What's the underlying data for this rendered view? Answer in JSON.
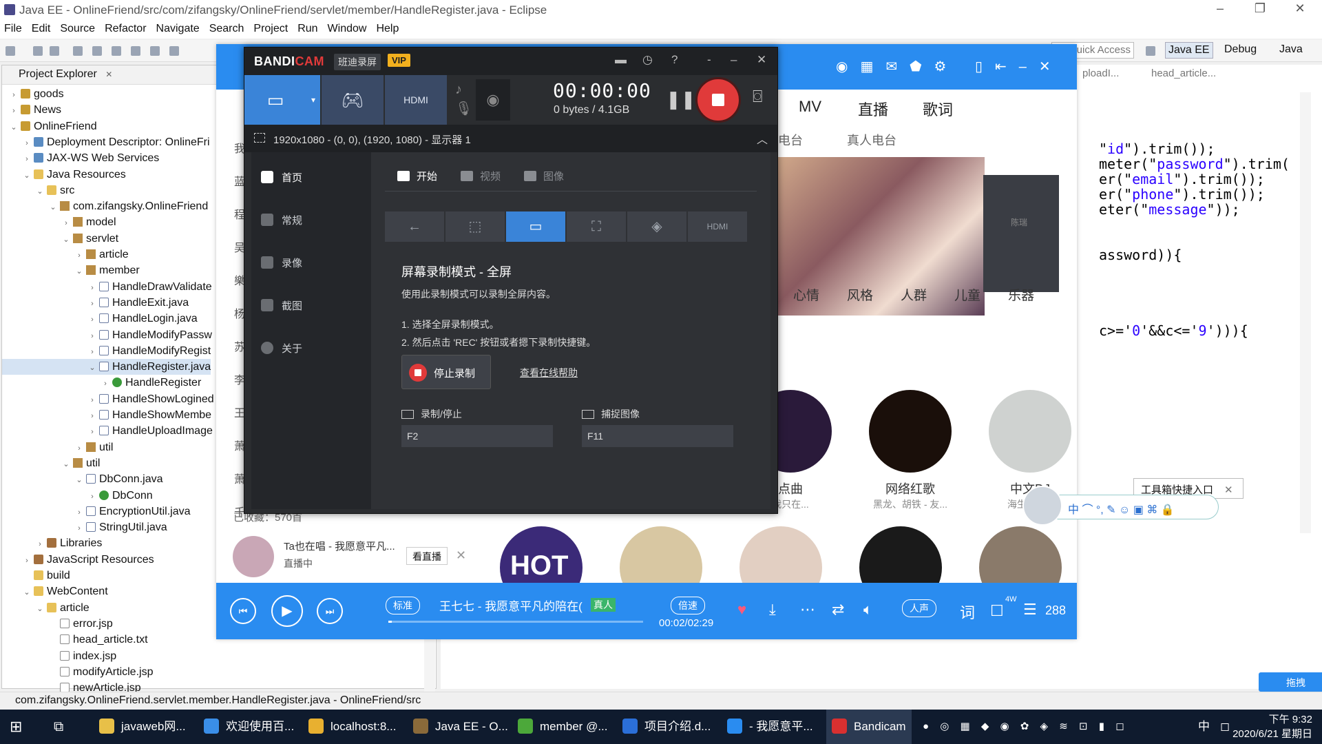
{
  "eclipse": {
    "title": "Java EE - OnlineFriend/src/com/zifangsky/OnlineFriend/servlet/member/HandleRegister.java - Eclipse",
    "menu": [
      "File",
      "Edit",
      "Source",
      "Refactor",
      "Navigate",
      "Search",
      "Project",
      "Run",
      "Window",
      "Help"
    ],
    "quick_access": "Quick Access",
    "perspectives": [
      "Java EE",
      "Debug",
      "Java"
    ],
    "explorer_title": "Project Explorer",
    "explorer_close": "✕",
    "tree": [
      {
        "label": "goods",
        "depth": 0,
        "twisty": "›",
        "icon": "proj"
      },
      {
        "label": "News",
        "depth": 0,
        "twisty": "›",
        "icon": "proj"
      },
      {
        "label": "OnlineFriend",
        "depth": 0,
        "twisty": "⌄",
        "icon": "proj"
      },
      {
        "label": "Deployment Descriptor: OnlineFri",
        "depth": 1,
        "twisty": "›",
        "icon": "web"
      },
      {
        "label": "JAX-WS Web Services",
        "depth": 1,
        "twisty": "›",
        "icon": "web"
      },
      {
        "label": "Java Resources",
        "depth": 1,
        "twisty": "⌄",
        "icon": "folder"
      },
      {
        "label": "src",
        "depth": 2,
        "twisty": "⌄",
        "icon": "folder"
      },
      {
        "label": "com.zifangsky.OnlineFriend",
        "depth": 3,
        "twisty": "⌄",
        "icon": "pkg"
      },
      {
        "label": "model",
        "depth": 4,
        "twisty": "›",
        "icon": "pkg"
      },
      {
        "label": "servlet",
        "depth": 4,
        "twisty": "⌄",
        "icon": "pkg"
      },
      {
        "label": "article",
        "depth": 5,
        "twisty": "›",
        "icon": "pkg"
      },
      {
        "label": "member",
        "depth": 5,
        "twisty": "⌄",
        "icon": "pkg"
      },
      {
        "label": "HandleDrawValidate",
        "depth": 6,
        "twisty": "›",
        "icon": "java"
      },
      {
        "label": "HandleExit.java",
        "depth": 6,
        "twisty": "›",
        "icon": "java"
      },
      {
        "label": "HandleLogin.java",
        "depth": 6,
        "twisty": "›",
        "icon": "java"
      },
      {
        "label": "HandleModifyPassw",
        "depth": 6,
        "twisty": "›",
        "icon": "java"
      },
      {
        "label": "HandleModifyRegist",
        "depth": 6,
        "twisty": "›",
        "icon": "java"
      },
      {
        "label": "HandleRegister.java",
        "depth": 6,
        "twisty": "⌄",
        "icon": "java",
        "selected": true
      },
      {
        "label": "HandleRegister",
        "depth": 7,
        "twisty": "›",
        "icon": "class"
      },
      {
        "label": "HandleShowLogined",
        "depth": 6,
        "twisty": "›",
        "icon": "java"
      },
      {
        "label": "HandleShowMembe",
        "depth": 6,
        "twisty": "›",
        "icon": "java"
      },
      {
        "label": "HandleUploadImage",
        "depth": 6,
        "twisty": "›",
        "icon": "java"
      },
      {
        "label": "util",
        "depth": 5,
        "twisty": "›",
        "icon": "pkg"
      },
      {
        "label": "util",
        "depth": 4,
        "twisty": "⌄",
        "icon": "pkg"
      },
      {
        "label": "DbConn.java",
        "depth": 5,
        "twisty": "⌄",
        "icon": "java"
      },
      {
        "label": "DbConn",
        "depth": 6,
        "twisty": "›",
        "icon": "class"
      },
      {
        "label": "EncryptionUtil.java",
        "depth": 5,
        "twisty": "›",
        "icon": "java"
      },
      {
        "label": "StringUtil.java",
        "depth": 5,
        "twisty": "›",
        "icon": "java"
      },
      {
        "label": "Libraries",
        "depth": 2,
        "twisty": "›",
        "icon": "lib"
      },
      {
        "label": "JavaScript Resources",
        "depth": 1,
        "twisty": "›",
        "icon": "lib"
      },
      {
        "label": "build",
        "depth": 1,
        "twisty": "",
        "icon": "folder"
      },
      {
        "label": "WebContent",
        "depth": 1,
        "twisty": "⌄",
        "icon": "folder"
      },
      {
        "label": "article",
        "depth": 2,
        "twisty": "⌄",
        "icon": "folder"
      },
      {
        "label": "error.jsp",
        "depth": 3,
        "twisty": "",
        "icon": "file"
      },
      {
        "label": "head_article.txt",
        "depth": 3,
        "twisty": "",
        "icon": "file"
      },
      {
        "label": "index.jsp",
        "depth": 3,
        "twisty": "",
        "icon": "file"
      },
      {
        "label": "modifyArticle.jsp",
        "depth": 3,
        "twisty": "",
        "icon": "file"
      },
      {
        "label": "newArticle.jsp",
        "depth": 3,
        "twisty": "",
        "icon": "file"
      }
    ],
    "editor_tabs": [
      "ploadI...",
      "head_article..."
    ],
    "code_lines": [
      {
        "parts": [
          [
            "",
            "\""
          ],
          [
            "s",
            "id"
          ],
          [
            "",
            "\").trim());"
          ]
        ]
      },
      {
        "parts": [
          [
            "",
            "meter(\""
          ],
          [
            "s",
            "password"
          ],
          [
            "",
            "\").trim("
          ]
        ]
      },
      {
        "parts": [
          [
            "",
            "er(\""
          ],
          [
            "s",
            "email"
          ],
          [
            "",
            "\").trim());"
          ]
        ]
      },
      {
        "parts": [
          [
            "",
            "er(\""
          ],
          [
            "s",
            "phone"
          ],
          [
            "",
            "\").trim());"
          ]
        ]
      },
      {
        "parts": [
          [
            "",
            "eter(\""
          ],
          [
            "s",
            "message"
          ],
          [
            "",
            "\"));"
          ]
        ]
      },
      {
        "parts": [
          [
            "",
            "assword)){"
          ]
        ]
      },
      {
        "parts": [
          [
            "",
            "c>='"
          ],
          [
            "s",
            "0"
          ],
          [
            "",
            "'&&c<='"
          ],
          [
            "s",
            "9"
          ],
          [
            "",
            "'))){"
          ]
        ]
      }
    ],
    "status_text": "com.zifangsky.OnlineFriend.servlet.member.HandleRegister.java - OnlineFriend/src"
  },
  "music": {
    "tabs": [
      "MV",
      "直播",
      "歌词"
    ],
    "sub_tabs": [
      "电台",
      "真人电台"
    ],
    "banner_caption": "陈瑞",
    "categories": [
      "心情",
      "风格",
      "人群",
      "儿童",
      "乐器"
    ],
    "playlists": [
      {
        "title": "点曲",
        "sub": "我只在..."
      },
      {
        "title": "网络红歌",
        "sub": "黑龙、胡铁 - 友..."
      },
      {
        "title": "中文DJ",
        "sub": "海生 - 三..."
      }
    ],
    "bottom_labels": [
      "HOT"
    ],
    "favorites_count": "已收藏：570首",
    "left_partial": [
      "我",
      "蓝",
      "程",
      "吴",
      "樂",
      "杨",
      "苏",
      "李",
      "王",
      "萧",
      "萧",
      "千"
    ],
    "live": {
      "title": "Ta也在唱 - 我愿意平凡...",
      "status": "直播中",
      "watch_button": "看直播",
      "close": "✕"
    },
    "player": {
      "quality": "标准",
      "song": "王七七 - 我愿意平凡的陪在(",
      "badge": "真人",
      "speed": "倍速",
      "time": "00:02/02:29",
      "progress": 0.013,
      "voice": "人声",
      "lyrics": "词",
      "comments": "4W",
      "playlist_count": "288"
    }
  },
  "bandicam": {
    "logo_main": "BANDI",
    "logo_cam": "CAM",
    "brand": "班迪录屏",
    "vip": "VIP",
    "timer": "00:00:00",
    "bytes": "0 bytes / 4.1GB",
    "area": "1920x1080 - (0, 0), (1920, 1080) - 显示器 1",
    "nav": [
      "首页",
      "常规",
      "录像",
      "截图",
      "关于"
    ],
    "tabs": [
      "开始",
      "视频",
      "图像"
    ],
    "heading": "屏幕录制模式 - 全屏",
    "description": "使用此录制模式可以录制全屏内容。",
    "steps": [
      "1. 选择全屏录制模式。",
      "2. 然后点击 'REC' 按钮或者摁下录制快捷键。"
    ],
    "stop_button": "停止录制",
    "help_link": "查看在线帮助",
    "hotkeys": [
      {
        "label": "录制/停止",
        "value": "F2"
      },
      {
        "label": "捕捉图像",
        "value": "F11"
      }
    ]
  },
  "overlays": {
    "toolbox": "工具箱快捷入口",
    "ime": "中 ⌒ °, ✎ ☺ ▣ ⌘ 🔒",
    "fab": "拖拽"
  },
  "taskbar": {
    "items": [
      {
        "label": "javaweb网...",
        "color": "#e8c048"
      },
      {
        "label": "欢迎使用百...",
        "color": "#3a8ee8"
      },
      {
        "label": "localhost:8...",
        "color": "#e8b030"
      },
      {
        "label": "Java EE - O...",
        "color": "#8a6a3a"
      },
      {
        "label": "member @...",
        "color": "#4ca83a"
      },
      {
        "label": "项目介绍.d...",
        "color": "#2b6fd8"
      },
      {
        "label": "- 我愿意平...",
        "color": "#2a8cf0"
      },
      {
        "label": "Bandicam",
        "color": "#d83030"
      }
    ],
    "time": "下午 9:32",
    "date": "2020/6/21 星期日",
    "tray": "中"
  }
}
